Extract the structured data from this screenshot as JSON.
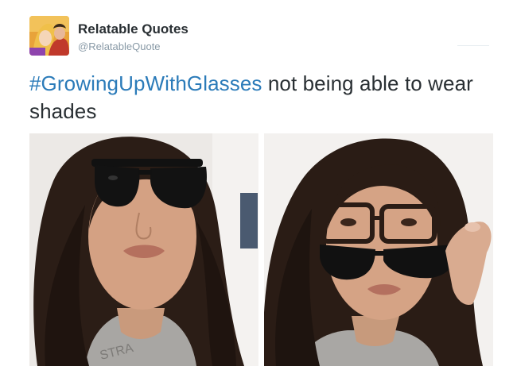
{
  "tweet": {
    "display_name": "Relatable Quotes",
    "handle": "@RelatableQuote",
    "hashtag": "#GrowingUpWithGlasses",
    "text": " not being able to wear shades",
    "shirt_text": "STRA"
  },
  "colors": {
    "hashtag": "#2b7bb9",
    "text": "#292f33",
    "handle": "#8899a6"
  }
}
